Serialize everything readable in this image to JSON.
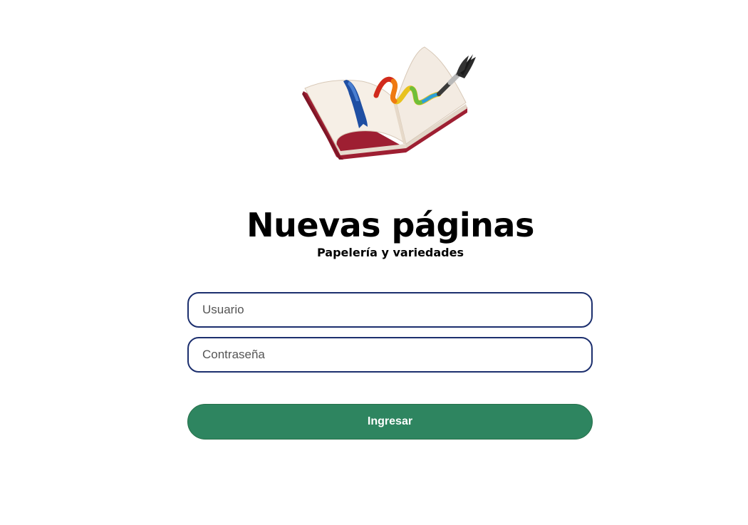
{
  "brand": {
    "title": "Nuevas páginas",
    "subtitle": "Papelería y variedades",
    "logo_icon": "open-book-paintbrush-icon"
  },
  "login": {
    "username_placeholder": "Usuario",
    "username_value": "",
    "password_placeholder": "Contraseña",
    "password_value": "",
    "submit_label": "Ingresar"
  },
  "colors": {
    "field_border": "#1c2f6e",
    "button_bg": "#2e8560",
    "button_text": "#ffffff",
    "book_cover": "#b0263a",
    "ribbon": "#1f4fa3"
  }
}
